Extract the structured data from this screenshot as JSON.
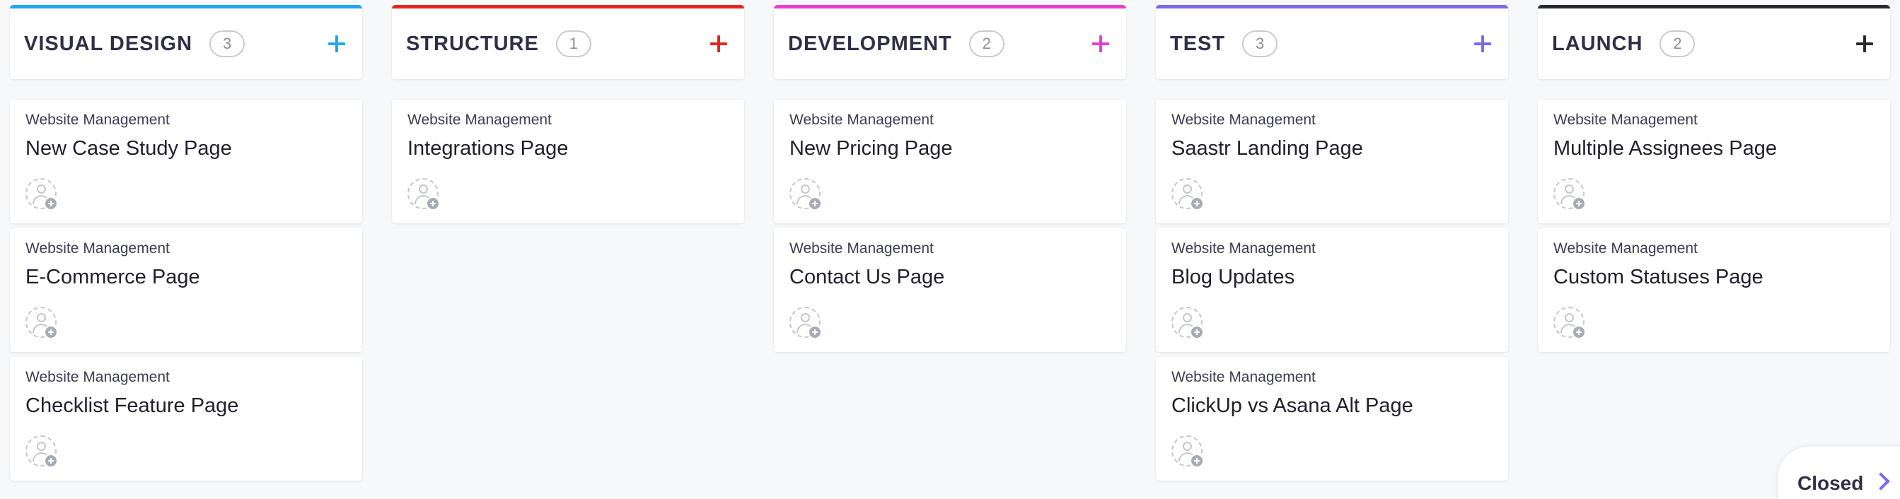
{
  "columns": [
    {
      "title": "VISUAL DESIGN",
      "count": "3",
      "accent": "#1fa7f0",
      "cards": [
        {
          "list": "Website Management",
          "title": "New Case Study Page"
        },
        {
          "list": "Website Management",
          "title": "E-Commerce Page"
        },
        {
          "list": "Website Management",
          "title": "Checklist Feature Page"
        }
      ]
    },
    {
      "title": "STRUCTURE",
      "count": "1",
      "accent": "#e5261f",
      "cards": [
        {
          "list": "Website Management",
          "title": "Integrations Page"
        }
      ]
    },
    {
      "title": "DEVELOPMENT",
      "count": "2",
      "accent": "#e83fd1",
      "cards": [
        {
          "list": "Website Management",
          "title": "New Pricing Page"
        },
        {
          "list": "Website Management",
          "title": "Contact Us Page"
        }
      ]
    },
    {
      "title": "TEST",
      "count": "3",
      "accent": "#7b68ee",
      "cards": [
        {
          "list": "Website Management",
          "title": "Saastr Landing Page"
        },
        {
          "list": "Website Management",
          "title": "Blog Updates"
        },
        {
          "list": "Website Management",
          "title": "ClickUp vs Asana Alt Page"
        }
      ]
    },
    {
      "title": "LAUNCH",
      "count": "2",
      "accent": "#2a2a2a",
      "cards": [
        {
          "list": "Website Management",
          "title": "Multiple Assignees Page"
        },
        {
          "list": "Website Management",
          "title": "Custom Statuses Page"
        }
      ]
    }
  ],
  "closed": {
    "label": "Closed",
    "icon": "chevron-right-icon",
    "accent": "#7b68ee"
  }
}
